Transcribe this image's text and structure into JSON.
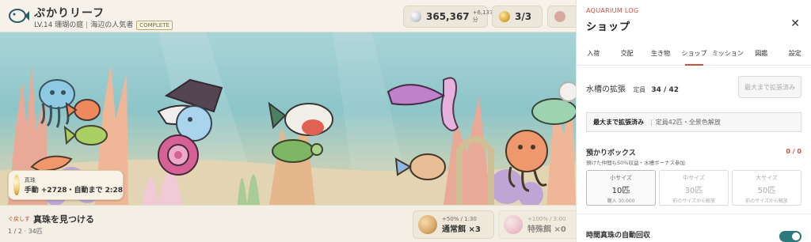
{
  "header": {
    "title": "ぷかりリーフ",
    "level": "LV.14 珊瑚の庭",
    "rank": "海辺の人気者",
    "badge": "COMPLETE"
  },
  "stats": {
    "coins": "365,367",
    "coin_rate": "+6,137/分",
    "fish": "3/3"
  },
  "pearl": {
    "label": "真珠",
    "value": "手動 +2728・自動まで 2:28"
  },
  "goal": {
    "back": "ぐ戻しす",
    "title": "真珠を見つける",
    "progress": "1 / 2 · 34匹"
  },
  "foods": [
    {
      "meta": "+50% / 1:30",
      "name": "通常餌 ×3"
    },
    {
      "meta": "+100% / 3:00",
      "name": "特殊餌 ×0"
    }
  ],
  "panel": {
    "kicker": "AQUARIUM LOG",
    "title": "ショップ",
    "close": "✕",
    "tabs": [
      "入荷",
      "交配",
      "生き物",
      "ショップ",
      "ミッション",
      "図鑑",
      "設定"
    ],
    "expand": {
      "title": "水槽の拡張",
      "capacity_label": "定員",
      "capacity": "34 / 42",
      "button": "最大まで拡張済み",
      "max_title": "最大まで拡張済み",
      "max_desc": "定員42匹・全景色解放"
    },
    "storage": {
      "title": "預かりボックス",
      "count": "0 / 0",
      "desc": "預けた仲間も50%収益・水槽ボーナス参加",
      "sizes": [
        {
          "name": "小サイズ",
          "cap": "10匹",
          "price": "購入 30,000"
        },
        {
          "name": "中サイズ",
          "cap": "30匹",
          "price": "前のサイズから解放"
        },
        {
          "name": "大サイズ",
          "cap": "50匹",
          "price": "前のサイズから解放"
        }
      ]
    },
    "auto": {
      "title": "時間真珠の自動回収"
    }
  },
  "colors": {
    "accent": "#c8523e",
    "toggle": "#2d7a7e"
  }
}
